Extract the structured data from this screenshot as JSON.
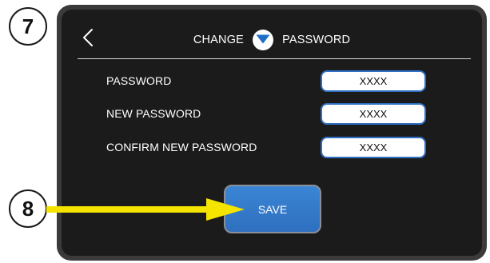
{
  "callouts": {
    "step_top": "7",
    "step_bottom": "8"
  },
  "header": {
    "title_left": "CHANGE",
    "title_right": "PASSWORD",
    "back_icon": "chevron-left-icon",
    "logo_icon": "brand-logo-icon"
  },
  "form": {
    "fields": [
      {
        "label": "PASSWORD",
        "value": "XXXX"
      },
      {
        "label": "NEW PASSWORD",
        "value": "XXXX"
      },
      {
        "label": "CONFIRM NEW PASSWORD",
        "value": "XXXX"
      }
    ],
    "save_label": "SAVE"
  },
  "colors": {
    "screen_bg": "#1b1b1b",
    "frame": "#3a3a3a",
    "accent_blue": "#2f6fc4",
    "arrow_yellow": "#f5e400"
  }
}
